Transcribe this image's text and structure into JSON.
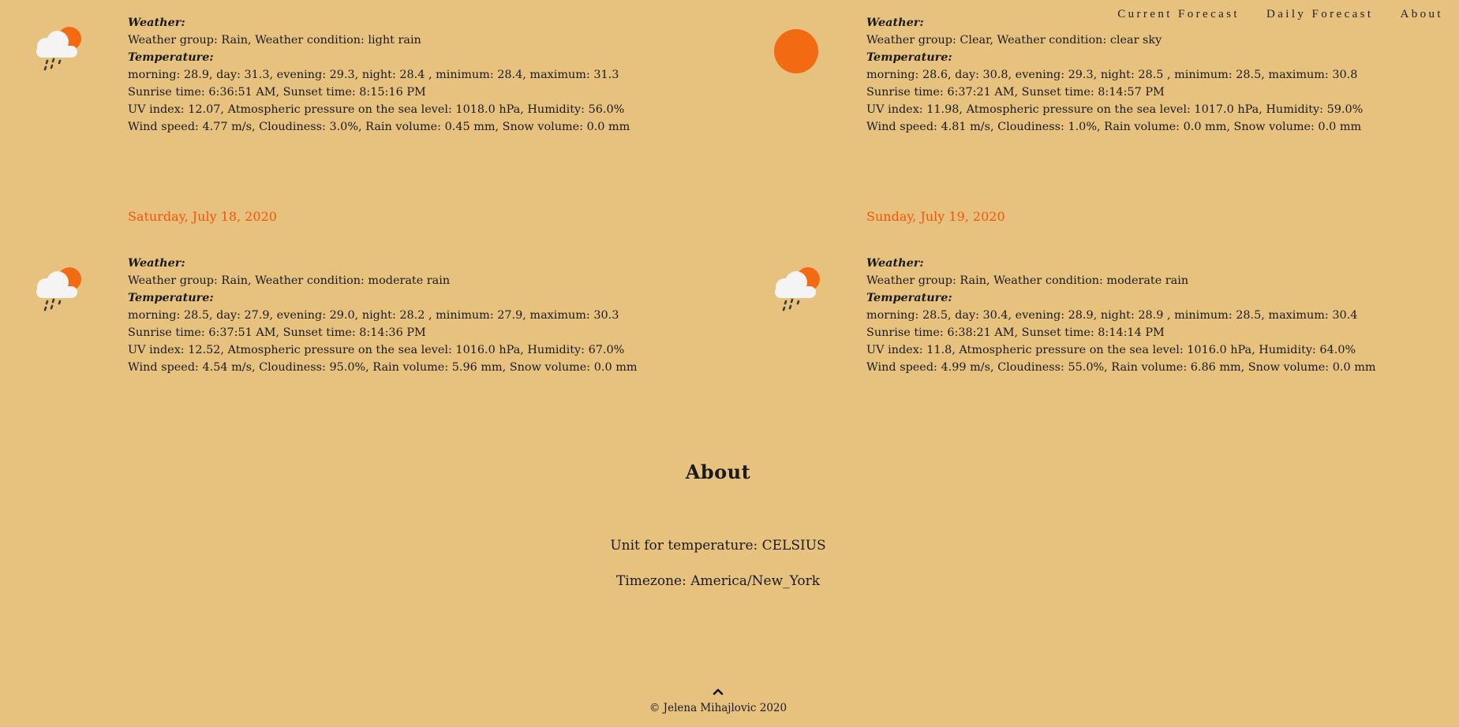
{
  "nav": {
    "items": [
      "Current Forecast",
      "Daily Forecast",
      "About"
    ]
  },
  "days": [
    {
      "date": "",
      "icon": "rain-cloud-sun-icon",
      "weather_label": "Weather:",
      "weather": "Weather group: Rain, Weather condition: light rain",
      "temperature_label": "Temperature:",
      "temperature": "morning: 28.9, day: 31.3, evening: 29.3, night: 28.4 , minimum: 28.4, maximum: 31.3",
      "sun": "Sunrise time: 6:36:51 AM, Sunset time: 8:15:16 PM",
      "uv": "UV index: 12.07, Atmospheric pressure on the sea level: 1018.0 hPa, Humidity: 56.0%",
      "wind": "Wind speed: 4.77 m/s, Cloudiness: 3.0%, Rain volume: 0.45 mm, Snow volume: 0.0 mm"
    },
    {
      "date": "",
      "icon": "sun-icon",
      "weather_label": "Weather:",
      "weather": "Weather group: Clear, Weather condition: clear sky",
      "temperature_label": "Temperature:",
      "temperature": "morning: 28.6, day: 30.8, evening: 29.3, night: 28.5 , minimum: 28.5, maximum: 30.8",
      "sun": "Sunrise time: 6:37:21 AM, Sunset time: 8:14:57 PM",
      "uv": "UV index: 11.98, Atmospheric pressure on the sea level: 1017.0 hPa, Humidity: 59.0%",
      "wind": "Wind speed: 4.81 m/s, Cloudiness: 1.0%, Rain volume: 0.0 mm, Snow volume: 0.0 mm"
    },
    {
      "date": "Saturday, July 18, 2020",
      "icon": "rain-cloud-sun-icon",
      "weather_label": "Weather:",
      "weather": "Weather group: Rain, Weather condition: moderate rain",
      "temperature_label": "Temperature:",
      "temperature": "morning: 28.5, day: 27.9, evening: 29.0, night: 28.2 , minimum: 27.9, maximum: 30.3",
      "sun": "Sunrise time: 6:37:51 AM, Sunset time: 8:14:36 PM",
      "uv": "UV index: 12.52, Atmospheric pressure on the sea level: 1016.0 hPa, Humidity: 67.0%",
      "wind": "Wind speed: 4.54 m/s, Cloudiness: 95.0%, Rain volume: 5.96 mm, Snow volume: 0.0 mm"
    },
    {
      "date": "Sunday, July 19, 2020",
      "icon": "rain-cloud-sun-icon",
      "weather_label": "Weather:",
      "weather": "Weather group: Rain, Weather condition: moderate rain",
      "temperature_label": "Temperature:",
      "temperature": "morning: 28.5, day: 30.4, evening: 28.9, night: 28.9 , minimum: 28.5, maximum: 30.4",
      "sun": "Sunrise time: 6:38:21 AM, Sunset time: 8:14:14 PM",
      "uv": "UV index: 11.8, Atmospheric pressure on the sea level: 1016.0 hPa, Humidity: 64.0%",
      "wind": "Wind speed: 4.99 m/s, Cloudiness: 55.0%, Rain volume: 6.86 mm, Snow volume: 0.0 mm"
    }
  ],
  "about": {
    "title": "About",
    "unit": "Unit for temperature: CELSIUS",
    "timezone": "Timezone: America/New_York"
  },
  "footer": {
    "up_icon": "chevron-up-icon",
    "copyright": "© Jelena Mihajlovic 2020"
  },
  "colors": {
    "background": "#e6c27e",
    "accent": "#f1560e",
    "sun": "#f26a12"
  }
}
